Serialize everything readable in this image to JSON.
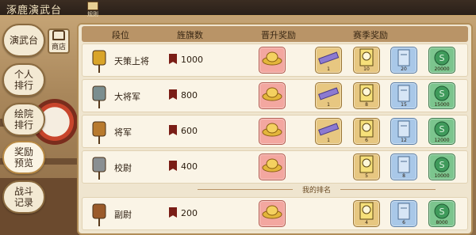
{
  "title": "涿鹿演武台",
  "rules_label": "规则",
  "shop_label": "商店",
  "nav": [
    {
      "label": "演武台"
    },
    {
      "label": "个人排行"
    },
    {
      "label": "绘院排行"
    },
    {
      "label": "奖励预览"
    },
    {
      "label": "战斗记录"
    }
  ],
  "columns": {
    "rank": "段位",
    "flags": "旌旗数",
    "promotion": "晋升奖励",
    "season": "赛季奖励"
  },
  "my_rank_label": "我的排名",
  "rows": [
    {
      "rank": "天策上将",
      "flags": "1000",
      "promo_qty": "",
      "season": [
        {
          "icon": "purple-scroll",
          "qty": "1"
        },
        {
          "icon": "portrait-card",
          "qty": "10"
        },
        {
          "icon": "paper-stack",
          "qty": "20"
        },
        {
          "icon": "jade-token",
          "qty": "20000"
        }
      ]
    },
    {
      "rank": "大将军",
      "flags": "800",
      "promo_qty": "",
      "season": [
        {
          "icon": "purple-scroll",
          "qty": "1"
        },
        {
          "icon": "portrait-card",
          "qty": "8"
        },
        {
          "icon": "paper-stack",
          "qty": "15"
        },
        {
          "icon": "jade-token",
          "qty": "15000"
        }
      ]
    },
    {
      "rank": "将军",
      "flags": "600",
      "promo_qty": "",
      "season": [
        {
          "icon": "purple-scroll",
          "qty": "1"
        },
        {
          "icon": "portrait-card",
          "qty": "6"
        },
        {
          "icon": "paper-stack",
          "qty": "12"
        },
        {
          "icon": "jade-token",
          "qty": "12000"
        }
      ]
    },
    {
      "rank": "校尉",
      "flags": "400",
      "promo_qty": "",
      "season": [
        {
          "icon": "portrait-card",
          "qty": "5"
        },
        {
          "icon": "paper-stack",
          "qty": "8"
        },
        {
          "icon": "jade-token",
          "qty": "10000"
        }
      ]
    },
    {
      "rank": "副尉",
      "flags": "200",
      "promo_qty": "",
      "season": [
        {
          "icon": "portrait-card",
          "qty": "4"
        },
        {
          "icon": "paper-stack",
          "qty": "6"
        },
        {
          "icon": "jade-token",
          "qty": "8000"
        }
      ]
    }
  ],
  "colors": {
    "promo_bg": "#f3a7a0",
    "jade": "#7cc58e",
    "gold": "#e7c781",
    "paper": "#a9c8e8"
  }
}
